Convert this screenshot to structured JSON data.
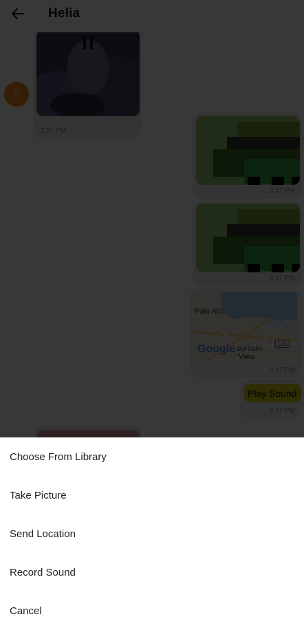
{
  "app_bar": {
    "title": "Helia",
    "back_icon": "arrow-left-icon"
  },
  "messages": [
    {
      "direction": "incoming",
      "type": "image",
      "time": "2:57 PM",
      "avatar_initial": "E"
    },
    {
      "direction": "outgoing",
      "type": "image",
      "time": "3:17 PM"
    },
    {
      "direction": "outgoing",
      "type": "image",
      "time": "3:17 PM"
    },
    {
      "direction": "outgoing",
      "type": "map",
      "time": "3:17 PM",
      "map_labels": {
        "city1": "Palo Alto",
        "city2_line1": "ountain",
        "city2_line2": "View",
        "route": "101",
        "logo": "Google"
      }
    },
    {
      "direction": "outgoing",
      "type": "sound",
      "time": "3:17 PM",
      "button_label": "Play Sound"
    }
  ],
  "action_sheet": {
    "items": [
      "Choose From Library",
      "Take Picture",
      "Send Location",
      "Record Sound",
      "Cancel"
    ]
  },
  "colors": {
    "avatar": "#f1831d",
    "play_sound": "#d2cc15",
    "overlay": "rgba(0,0,0,0.78)"
  }
}
